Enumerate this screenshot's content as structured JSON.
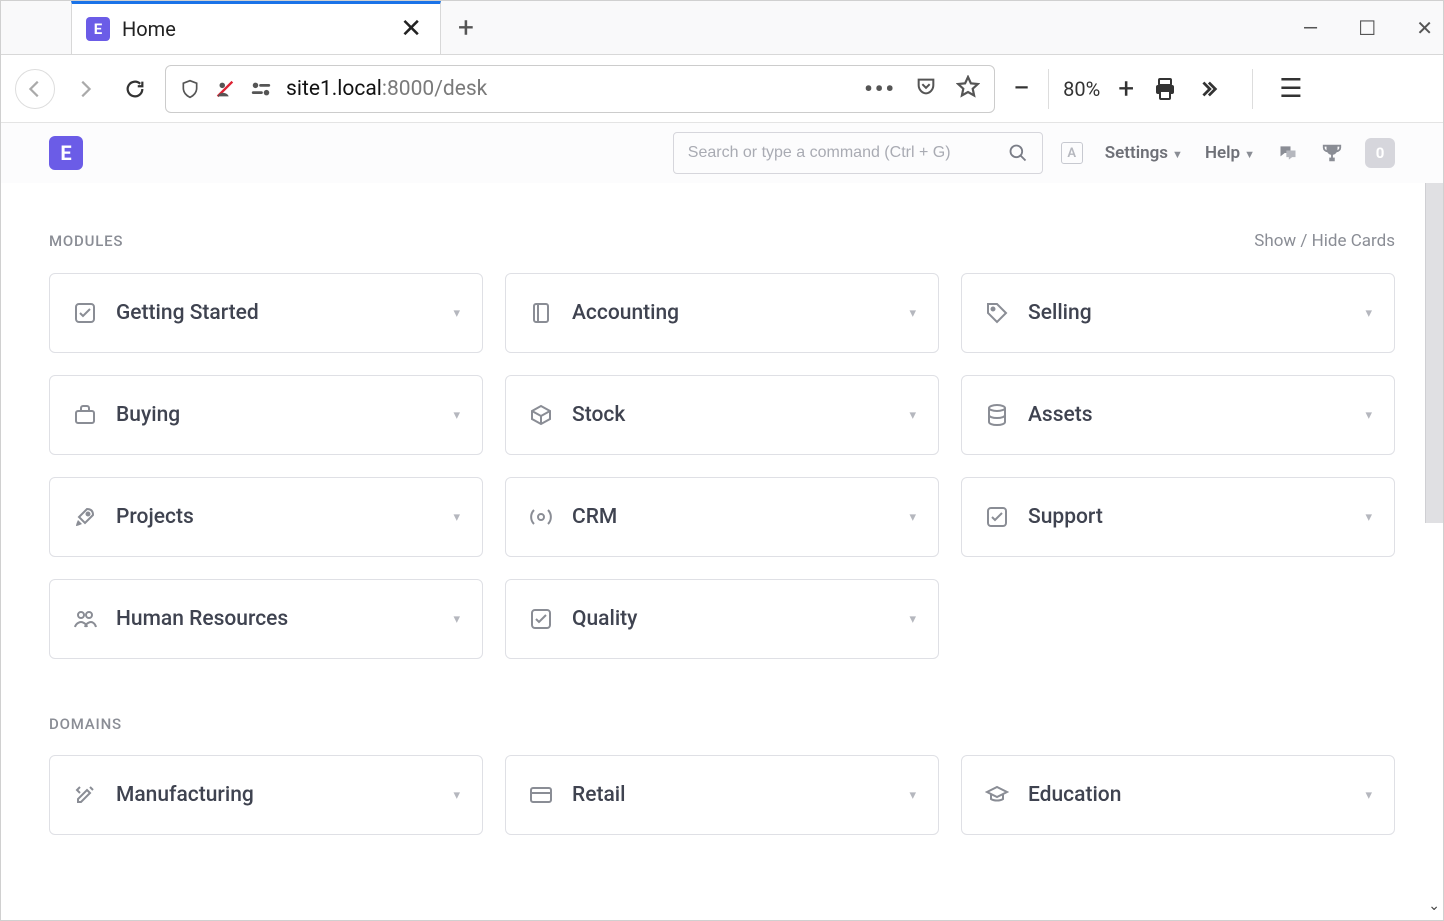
{
  "browser": {
    "tab_title": "Home",
    "url_host": "site1.local",
    "url_port_path": ":8000/desk",
    "zoom": "80%"
  },
  "app_header": {
    "search_placeholder": "Search or type a command (Ctrl + G)",
    "settings_label": "Settings",
    "help_label": "Help",
    "notif_count": "0"
  },
  "sections": {
    "modules": {
      "title": "MODULES",
      "show_hide": "Show / Hide Cards",
      "cards": [
        {
          "label": "Getting Started",
          "icon": "check-square"
        },
        {
          "label": "Accounting",
          "icon": "book"
        },
        {
          "label": "Selling",
          "icon": "tag"
        },
        {
          "label": "Buying",
          "icon": "briefcase"
        },
        {
          "label": "Stock",
          "icon": "box"
        },
        {
          "label": "Assets",
          "icon": "database"
        },
        {
          "label": "Projects",
          "icon": "rocket"
        },
        {
          "label": "CRM",
          "icon": "broadcast"
        },
        {
          "label": "Support",
          "icon": "check-square"
        },
        {
          "label": "Human Resources",
          "icon": "people"
        },
        {
          "label": "Quality",
          "icon": "check-square"
        }
      ]
    },
    "domains": {
      "title": "DOMAINS",
      "cards": [
        {
          "label": "Manufacturing",
          "icon": "tools"
        },
        {
          "label": "Retail",
          "icon": "credit-card"
        },
        {
          "label": "Education",
          "icon": "graduation"
        }
      ]
    }
  }
}
